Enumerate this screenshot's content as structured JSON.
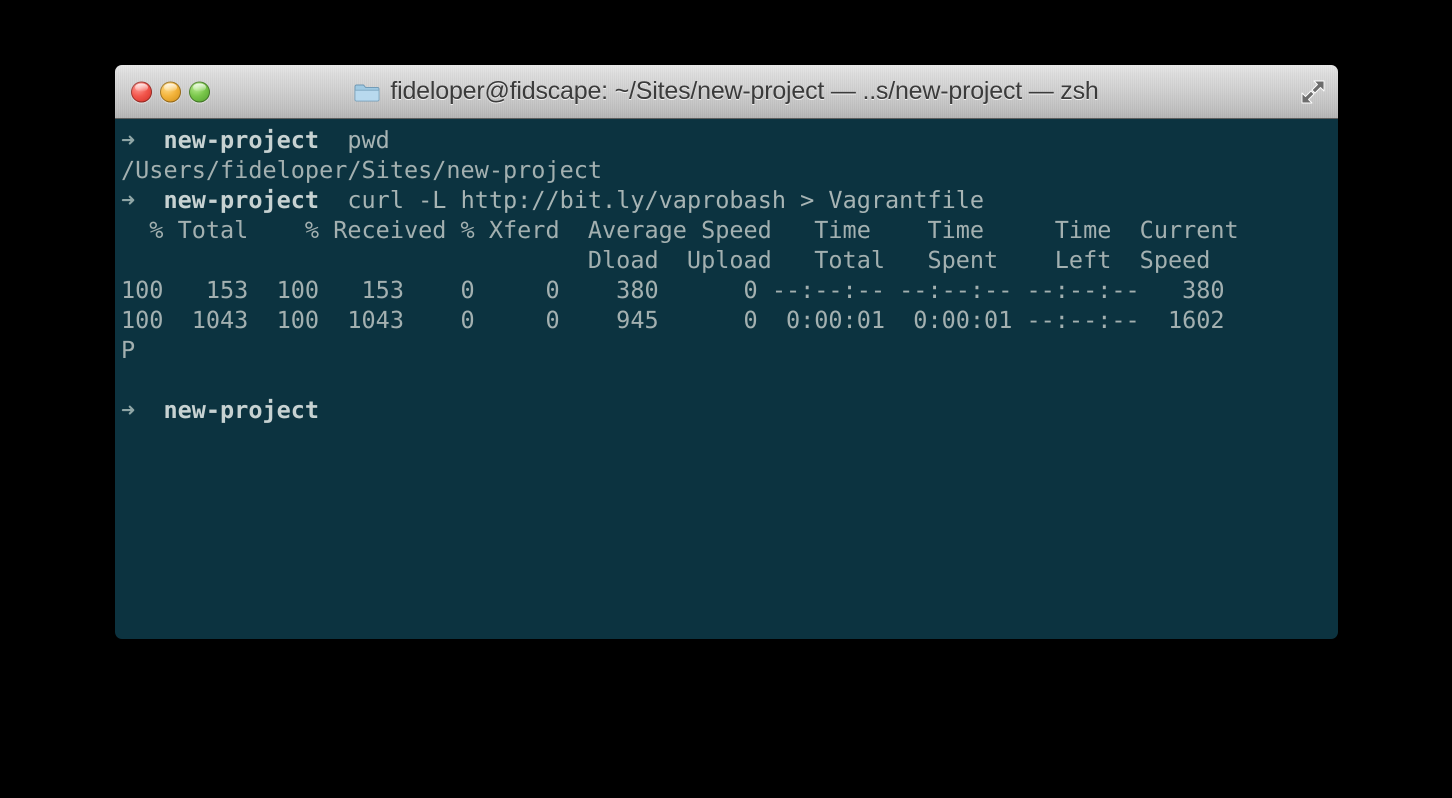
{
  "window": {
    "title": "fideloper@fidscape: ~/Sites/new-project — ..s/new-project — zsh",
    "shell": "zsh",
    "folder_icon": "folder-icon",
    "controls": {
      "close": "close-button",
      "minimize": "minimize-button",
      "maximize": "maximize-button",
      "fullscreen": "fullscreen-button"
    },
    "colors": {
      "background": "#0c3340",
      "foreground": "#a7b4b4",
      "prompt_bold": "#c7d2d2",
      "arrow": "#8fa6a6",
      "titlebar_top": "#e8e8e8",
      "titlebar_bottom": "#b4b4b4",
      "title_text": "#3b3b3b",
      "close_red": "#f2564c",
      "minimize_yellow": "#f3b43c",
      "maximize_green": "#79c64a"
    }
  },
  "terminal": {
    "prompt_symbol": "➜",
    "prompt_path": "new-project",
    "lines": [
      {
        "type": "prompt",
        "arrow": "➜",
        "gap1": "  ",
        "path": "new-project",
        "gap2": "  ",
        "command": "pwd"
      },
      {
        "type": "output",
        "text": "/Users/fideloper/Sites/new-project"
      },
      {
        "type": "prompt",
        "arrow": "➜",
        "gap1": "  ",
        "path": "new-project",
        "gap2": "  ",
        "command": "curl -L http://bit.ly/vaprobash > Vagrantfile"
      },
      {
        "type": "output",
        "text": "  % Total    % Received % Xferd  Average Speed   Time    Time     Time  Current"
      },
      {
        "type": "output",
        "text": "                                 Dload  Upload   Total   Spent    Left  Speed"
      },
      {
        "type": "output",
        "text": "100   153  100   153    0     0    380      0 --:--:-- --:--:-- --:--:--   380"
      },
      {
        "type": "output",
        "text": "100  1043  100  1043    0     0    945      0  0:00:01  0:00:01 --:--:--  1602"
      },
      {
        "type": "output",
        "text": "P"
      },
      {
        "type": "blank",
        "text": ""
      },
      {
        "type": "prompt",
        "arrow": "➜",
        "gap1": "  ",
        "path": "new-project",
        "gap2": "",
        "command": ""
      }
    ]
  }
}
